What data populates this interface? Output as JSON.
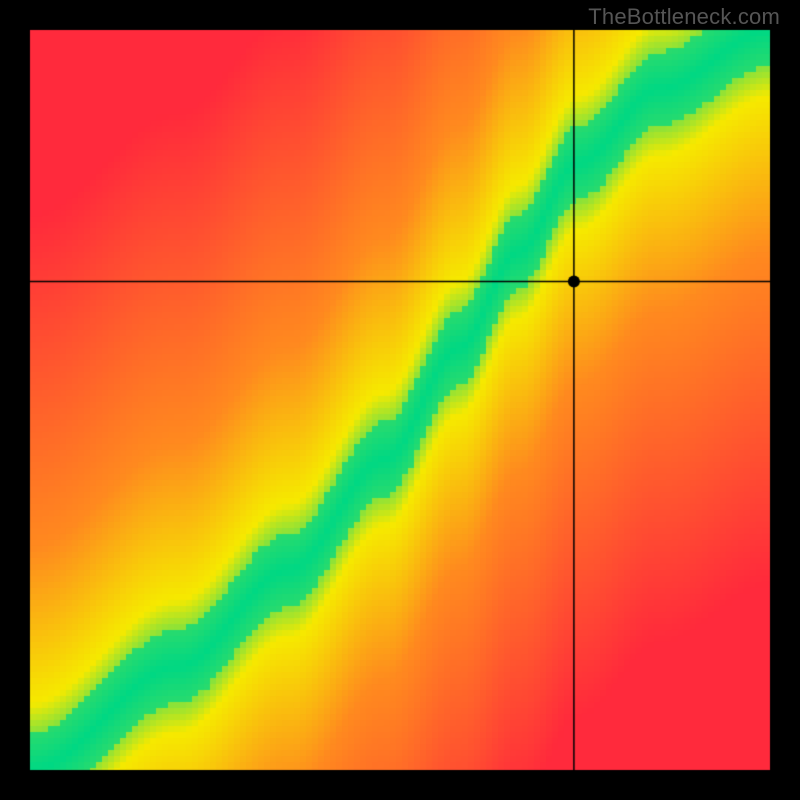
{
  "attribution": "TheBottleneck.com",
  "chart_data": {
    "type": "heatmap",
    "title": "",
    "xlabel": "",
    "ylabel": "",
    "xlim": [
      0,
      1
    ],
    "ylim": [
      0,
      1
    ],
    "marker": {
      "x": 0.735,
      "y": 0.66
    },
    "crosshair": {
      "x": 0.735,
      "y": 0.66
    },
    "optimal_band": {
      "description": "diagonal green band from lower-left to upper-right; slightly S-curved, steeper in upper half",
      "approx_points_xy": [
        [
          0.0,
          0.0
        ],
        [
          0.2,
          0.14
        ],
        [
          0.35,
          0.27
        ],
        [
          0.48,
          0.42
        ],
        [
          0.58,
          0.57
        ],
        [
          0.66,
          0.7
        ],
        [
          0.74,
          0.82
        ],
        [
          0.85,
          0.92
        ],
        [
          1.0,
          1.0
        ]
      ],
      "band_halfwidth_vertical": 0.05
    },
    "gradient_field": "distance from optimal band: 0→green, mid→yellow/orange, far→red",
    "outer_frame": "thick black border around plot area",
    "colors": {
      "green": "#00d884",
      "yellow": "#f6ea00",
      "orange": "#ff8a1f",
      "red": "#ff2a3c",
      "frame": "#000000"
    }
  }
}
